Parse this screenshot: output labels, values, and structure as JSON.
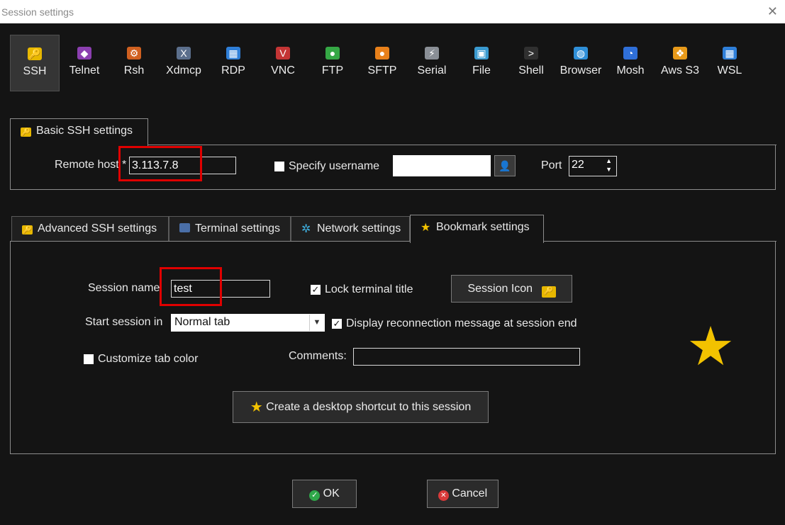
{
  "window": {
    "title": "Session settings",
    "close_glyph": "✕"
  },
  "toolbar": [
    {
      "label": "SSH",
      "icon": "ssh-key-icon",
      "glyph": "🔑",
      "color": "#e8b800",
      "active": true
    },
    {
      "label": "Telnet",
      "icon": "telnet-icon",
      "glyph": "◆",
      "color": "#8b3fb0"
    },
    {
      "label": "Rsh",
      "icon": "rsh-icon",
      "glyph": "⚙",
      "color": "#d06020"
    },
    {
      "label": "Xdmcp",
      "icon": "xdmcp-icon",
      "glyph": "X",
      "color": "#5b6f8c"
    },
    {
      "label": "RDP",
      "icon": "rdp-icon",
      "glyph": "▦",
      "color": "#2f7fd8"
    },
    {
      "label": "VNC",
      "icon": "vnc-icon",
      "glyph": "V",
      "color": "#c43535"
    },
    {
      "label": "FTP",
      "icon": "ftp-icon",
      "glyph": "●",
      "color": "#35a845"
    },
    {
      "label": "SFTP",
      "icon": "sftp-icon",
      "glyph": "●",
      "color": "#e8801a"
    },
    {
      "label": "Serial",
      "icon": "serial-plug-icon",
      "glyph": "⚡",
      "color": "#8a8f96"
    },
    {
      "label": "File",
      "icon": "file-monitor-icon",
      "glyph": "▣",
      "color": "#3a9ad0"
    },
    {
      "label": "Shell",
      "icon": "shell-terminal-icon",
      "glyph": ">",
      "color": "#303030"
    },
    {
      "label": "Browser",
      "icon": "browser-globe-icon",
      "glyph": "◍",
      "color": "#2f8fd8"
    },
    {
      "label": "Mosh",
      "icon": "mosh-satellite-icon",
      "glyph": "◔",
      "color": "#2f6fd8"
    },
    {
      "label": "Aws S3",
      "icon": "aws-s3-icon",
      "glyph": "❖",
      "color": "#e89a1a"
    },
    {
      "label": "WSL",
      "icon": "wsl-windows-icon",
      "glyph": "▦",
      "color": "#2f7fd8"
    }
  ],
  "basic": {
    "tab_label": "Basic SSH settings",
    "remote_host_label": "Remote host",
    "required_mark": "*",
    "remote_host_value": "3.113.7.8",
    "specify_username_label": "Specify username",
    "specify_username_checked": false,
    "username_value": "",
    "port_label": "Port",
    "port_value": "22"
  },
  "tabs": [
    {
      "label": "Advanced SSH settings",
      "icon": "ssh-key-icon"
    },
    {
      "label": "Terminal settings",
      "icon": "terminal-icon"
    },
    {
      "label": "Network settings",
      "icon": "network-star-icon"
    },
    {
      "label": "Bookmark settings",
      "icon": "bookmark-star-icon",
      "active": true
    }
  ],
  "bookmark": {
    "session_name_label": "Session name",
    "session_name_value": "test",
    "lock_title_label": "Lock terminal title",
    "lock_title_checked": true,
    "session_icon_label": "Session Icon",
    "start_session_label": "Start session in",
    "start_session_value": "Normal tab",
    "reconnect_label": "Display reconnection message at session end",
    "reconnect_checked": true,
    "tab_color_label": "Customize tab color",
    "tab_color_checked": false,
    "comments_label": "Comments:",
    "comments_value": "",
    "shortcut_label": "Create a desktop shortcut to this session"
  },
  "buttons": {
    "ok_label": "OK",
    "cancel_label": "Cancel"
  },
  "colors": {
    "accent_star": "#f2c200",
    "highlight": "#e00000",
    "ok_green": "#2fa84a",
    "cancel_red": "#d83a3a"
  }
}
